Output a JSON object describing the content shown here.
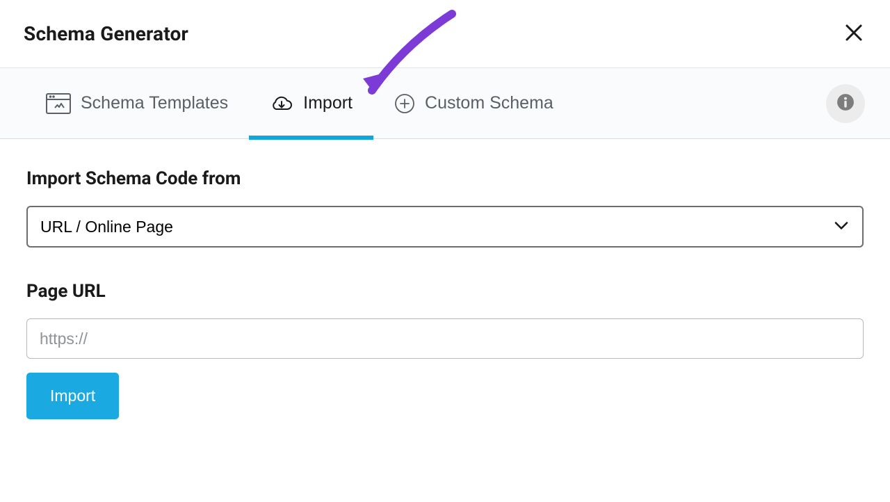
{
  "header": {
    "title": "Schema Generator"
  },
  "tabs": {
    "items": [
      {
        "label": "Schema Templates",
        "active": false
      },
      {
        "label": "Import",
        "active": true
      },
      {
        "label": "Custom Schema",
        "active": false
      }
    ]
  },
  "form": {
    "source_label": "Import Schema Code from",
    "source_selected": "URL / Online Page",
    "page_url_label": "Page URL",
    "page_url_placeholder": "https://",
    "page_url_value": "",
    "import_button": "Import"
  }
}
